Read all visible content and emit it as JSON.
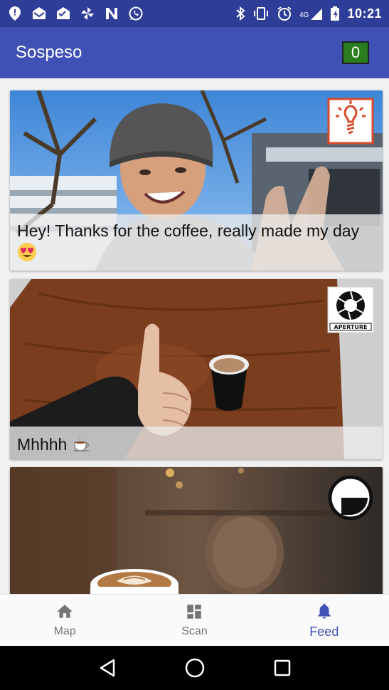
{
  "status_bar": {
    "time": "10:21",
    "network": "4G",
    "left_icons": [
      "location-icon",
      "mail-icon",
      "mail-alt-icon",
      "pinwheel-icon",
      "n-icon",
      "whatsapp-icon"
    ],
    "right_icons": [
      "bluetooth-icon",
      "vibrate-icon",
      "alarm-icon",
      "signal-icon",
      "battery-icon"
    ]
  },
  "app_bar": {
    "title": "Sospeso",
    "counter": "0",
    "counter_color": "#2a7d1f"
  },
  "theme": {
    "primary": "#3f51b5",
    "primary_dark": "#2e3d98"
  },
  "feed": {
    "posts": [
      {
        "caption": "Hey! Thanks for the coffee, really made my day",
        "emoji": "smiling-face-heart-eyes-icon",
        "logo": "lightbulb-logo-icon"
      },
      {
        "caption": "Mhhhh",
        "emoji": "hot-beverage-icon",
        "logo": "aperture-logo-icon"
      },
      {
        "caption": "",
        "emoji": "",
        "logo": "circle-square-logo-icon"
      }
    ],
    "aperture_logo_text": "APERTURE"
  },
  "bottom_nav": {
    "items": [
      {
        "label": "Map",
        "icon": "home-icon",
        "active": false
      },
      {
        "label": "Scan",
        "icon": "dashboard-icon",
        "active": false
      },
      {
        "label": "Feed",
        "icon": "bell-icon",
        "active": true
      }
    ]
  },
  "system_nav": {
    "icons": [
      "back-icon",
      "home-circle-icon",
      "recents-icon"
    ]
  }
}
